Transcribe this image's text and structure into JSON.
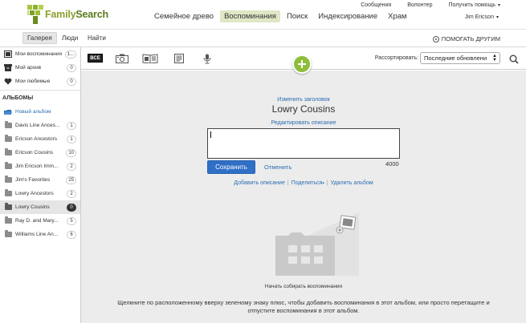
{
  "header": {
    "logo_prefix": "Family",
    "logo_suffix": "Search",
    "utility": {
      "messages": "Сообщения",
      "volunteer": "Волонтер",
      "help": "Получить помощь"
    },
    "nav": [
      {
        "label": "Семейное древо",
        "active": false
      },
      {
        "label": "Воспоминания",
        "active": true
      },
      {
        "label": "Поиск",
        "active": false
      },
      {
        "label": "Индексирование",
        "active": false
      },
      {
        "label": "Храм",
        "active": false
      }
    ],
    "user_name": "Jim Ericson"
  },
  "subnav": {
    "tabs": [
      {
        "label": "Галерея",
        "active": true
      },
      {
        "label": "Люди",
        "active": false
      },
      {
        "label": "Найти",
        "active": false
      }
    ],
    "share_label": "ПОМОГАТЬ ДРУГИМ"
  },
  "sidebar": {
    "top_items": [
      {
        "label": "Мои воспоминания",
        "count": "1...",
        "icon": "gallery-icon"
      },
      {
        "label": "Мой архив",
        "count": "0",
        "icon": "archive-icon"
      },
      {
        "label": "Мои любимые",
        "count": "0",
        "icon": "heart-icon"
      }
    ],
    "albums_heading": "АЛЬБОМЫ",
    "new_album": "Новый альбом",
    "albums": [
      {
        "label": "Davis Line Ances...",
        "count": "1"
      },
      {
        "label": "Ericson Ancestors",
        "count": "1"
      },
      {
        "label": "Ericson Cousins",
        "count": "10"
      },
      {
        "label": "Jim Ericson Imm...",
        "count": "2"
      },
      {
        "label": "Jim's Favorites",
        "count": "25"
      },
      {
        "label": "Lowry Ancestors",
        "count": "2"
      },
      {
        "label": "Lowry Cousins",
        "count": "0"
      },
      {
        "label": "Ray D. and Mary...",
        "count": "5"
      },
      {
        "label": "Williams Line An...",
        "count": "6"
      }
    ]
  },
  "toolbar": {
    "all_label": "ВСЕ",
    "sort_label": "Рассортировать:",
    "sort_value": "Последние обновлени"
  },
  "main": {
    "edit_title": "Изменить заголовок",
    "album_title": "Lowry Cousins",
    "edit_description": "Редактировать описание",
    "description_value": "",
    "save": "Сохранить",
    "cancel": "Отменить",
    "char_count": "4000",
    "add_description": "Добавить описание",
    "share": "Поделиться",
    "delete_album": "Удалить альбом",
    "start_text": "Начать собирать воспоминания",
    "instructions": "Щелкните по расположенному вверху зеленому знаку плюс, чтобы добавить воспоминания в этот альбом, или просто перетащите и отпустите воспоминания в этот альбом."
  }
}
